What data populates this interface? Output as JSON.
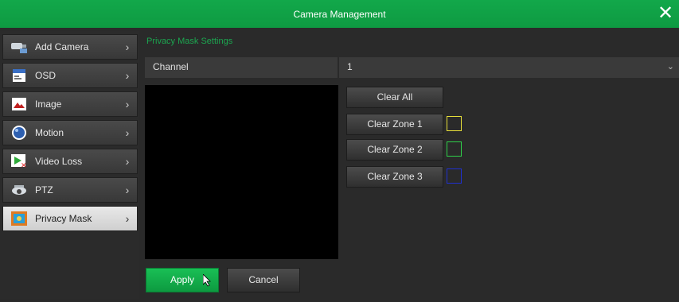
{
  "window": {
    "title": "Camera Management",
    "close_icon": "close-icon"
  },
  "sidebar": {
    "items": [
      {
        "label": "Add Camera",
        "icon": "add-camera-icon"
      },
      {
        "label": "OSD",
        "icon": "osd-icon"
      },
      {
        "label": "Image",
        "icon": "image-icon"
      },
      {
        "label": "Motion",
        "icon": "motion-icon"
      },
      {
        "label": "Video Loss",
        "icon": "video-loss-icon"
      },
      {
        "label": "PTZ",
        "icon": "ptz-icon"
      },
      {
        "label": "Privacy Mask",
        "icon": "privacy-mask-icon",
        "active": true
      }
    ],
    "chevron": "›"
  },
  "main": {
    "section_title": "Privacy Mask Settings",
    "channel_label": "Channel",
    "channel_value": "1",
    "buttons": {
      "clear_all": "Clear All",
      "clear_zone_1": "Clear Zone 1",
      "clear_zone_2": "Clear Zone 2",
      "clear_zone_3": "Clear Zone 3",
      "apply": "Apply",
      "cancel": "Cancel"
    },
    "zone_colors": {
      "zone1": "#e8e03a",
      "zone2": "#2fd04a",
      "zone3": "#2030d0"
    }
  },
  "colors": {
    "accent": "#12a84a"
  }
}
